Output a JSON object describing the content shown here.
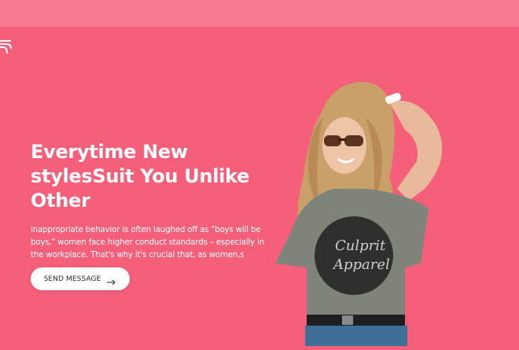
{
  "hero": {
    "headline": [
      "Everytime New",
      "stylesSuit You Unlike",
      "Other"
    ],
    "description": [
      "inappropriate behavior is often laughed off as \"boys will be",
      "boys,\" women face higher conduct standards – especially in",
      "the workplace. That's why it's crucial that, as women,s"
    ],
    "cta_label": "SEND MESSAGE",
    "cta_icon": "arrow-right-icon",
    "model_shirt_text": [
      "Culprit",
      "Apparel"
    ]
  },
  "colors": {
    "background": "#f55f7a",
    "topbar": "#f77a90",
    "text": "#ffffff",
    "button_bg": "#ffffff",
    "button_text": "#2a2a2a"
  }
}
